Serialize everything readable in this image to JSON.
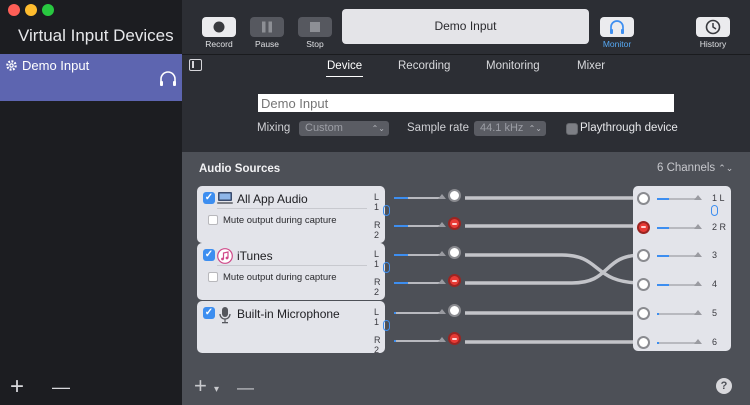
{
  "sidebar": {
    "title": "Virtual Input Devices",
    "devices": [
      {
        "name": "Demo Input",
        "icon": "gear-icon",
        "monitor_icon": "headphones-icon"
      }
    ],
    "add_label": "+",
    "remove_label": "—"
  },
  "toolbar": {
    "record_label": "Record",
    "pause_label": "Pause",
    "stop_label": "Stop",
    "title": "Demo Input",
    "monitor_label": "Monitor",
    "history_label": "History",
    "accent": "#56a8f3"
  },
  "tabs": [
    {
      "label": "Device",
      "active": true
    },
    {
      "label": "Recording",
      "active": false
    },
    {
      "label": "Monitoring",
      "active": false
    },
    {
      "label": "Mixer",
      "active": false
    }
  ],
  "device": {
    "name_placeholder": "Demo Input",
    "mixing_label": "Mixing",
    "mixing_value": "Custom",
    "sample_rate_label": "Sample rate",
    "sample_rate_value": "44.1 kHz",
    "playthrough_label": "Playthrough device",
    "playthrough_checked": false
  },
  "sources": {
    "title": "Audio Sources",
    "channels_label": "6 Channels",
    "items": [
      {
        "name": "All App Audio",
        "icon": "computer-icon",
        "checked": true,
        "mute_label": "Mute output during capture",
        "mute_checked": false,
        "left_label": "L 1",
        "right_label": "R 2",
        "left_level": 0.3,
        "right_level": 0.3
      },
      {
        "name": "iTunes",
        "icon": "music-note-icon",
        "checked": true,
        "mute_label": "Mute output during capture",
        "mute_checked": false,
        "left_label": "L 1",
        "right_label": "R 2",
        "left_level": 0.3,
        "right_level": 0.3
      },
      {
        "name": "Built-in Microphone",
        "icon": "microphone-icon",
        "checked": true,
        "left_label": "L 1",
        "right_label": "R 2",
        "left_level": 0.05,
        "right_level": 0.05
      }
    ],
    "outputs": [
      {
        "label": "1 L",
        "level": 0.3,
        "active": false
      },
      {
        "label": "2 R",
        "level": 0.3,
        "active": true
      },
      {
        "label": "3",
        "level": 0.3,
        "active": false
      },
      {
        "label": "4",
        "level": 0.3,
        "active": false
      },
      {
        "label": "5",
        "level": 0.05,
        "active": false
      },
      {
        "label": "6",
        "level": 0.05,
        "active": false
      }
    ]
  },
  "footer": {
    "add_label": "+",
    "menu_label": "▾",
    "remove_label": "—",
    "help_label": "?"
  }
}
